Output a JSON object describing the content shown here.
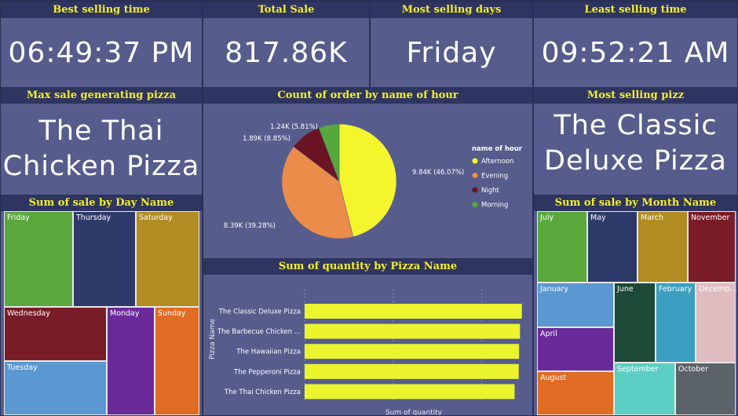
{
  "kpis": {
    "best_selling_time": {
      "title": "Best selling time",
      "value": "06:49:37 PM"
    },
    "total_sale": {
      "title": "Total Sale",
      "value": "817.86K"
    },
    "most_selling_days": {
      "title": "Most selling days",
      "value": "Friday"
    },
    "least_selling_time": {
      "title": "Least selling time",
      "value": "09:52:21 AM"
    }
  },
  "max_sale_pizza": {
    "title": "Max sale generating pizza",
    "line1": "The Thai",
    "line2": "Chicken Pizza"
  },
  "most_selling_pizz": {
    "title": "Most selling pizz",
    "line1": "The Classic",
    "line2": "Deluxe Pizza"
  },
  "day_treemap": {
    "title": "Sum of sale by Day Name",
    "tiles": [
      {
        "label": "Friday",
        "color": "#5aa83c"
      },
      {
        "label": "Thursday",
        "color": "#2e3a6a"
      },
      {
        "label": "Saturday",
        "color": "#b08c22"
      },
      {
        "label": "Wednesday",
        "color": "#7a1c28"
      },
      {
        "label": "Monday",
        "color": "#6b2a9a"
      },
      {
        "label": "Sunday",
        "color": "#e06b22"
      },
      {
        "label": "Tuesday",
        "color": "#5b97d0"
      }
    ]
  },
  "month_treemap": {
    "title": "Sum of sale by Month Name",
    "tiles": [
      {
        "label": "July",
        "color": "#5aa83c"
      },
      {
        "label": "May",
        "color": "#2e3a6a"
      },
      {
        "label": "March",
        "color": "#b08c22"
      },
      {
        "label": "November",
        "color": "#7a1c28"
      },
      {
        "label": "January",
        "color": "#5b97d0"
      },
      {
        "label": "June",
        "color": "#1e4a38"
      },
      {
        "label": "February",
        "color": "#3a9fc0"
      },
      {
        "label": "Decemb...",
        "color": "#e0bcc0"
      },
      {
        "label": "April",
        "color": "#6b2a9a"
      },
      {
        "label": "August",
        "color": "#e06b22"
      },
      {
        "label": "September",
        "color": "#5ccfc4"
      },
      {
        "label": "October",
        "color": "#5b6368"
      }
    ]
  },
  "chart_data": [
    {
      "type": "pie",
      "title": "Count of order by name of hour",
      "legend_title": "name of hour",
      "legend_position": "right",
      "slices": [
        {
          "name": "Afternoon",
          "value": 9.84,
          "label": "9.84K (46.07%)",
          "color": "#f5f52e"
        },
        {
          "name": "Evening",
          "value": 8.39,
          "label": "8.39K (39.28%)",
          "color": "#ec8c4a"
        },
        {
          "name": "Night",
          "value": 1.89,
          "label": "1.89K (8.85%)",
          "color": "#6a1424"
        },
        {
          "name": "Morning",
          "value": 1.24,
          "label": "1.24K (5.81%)",
          "color": "#56a83c"
        }
      ]
    },
    {
      "type": "bar",
      "orientation": "horizontal",
      "title": "Sum of quantity by Pizza Name",
      "xlabel": "Sum of quantity",
      "ylabel": "Pizza Name",
      "categories": [
        "The Classic Deluxe Pizza",
        "The Barbecue Chicken ...",
        "The Hawaiian Pizza",
        "The Pepperoni Pizza",
        "The Thai Chicken Pizza"
      ],
      "values": [
        2453,
        2432,
        2422,
        2418,
        2371
      ],
      "xlim": [
        0,
        2500
      ],
      "color": "#ebf52e",
      "grid": true
    }
  ]
}
